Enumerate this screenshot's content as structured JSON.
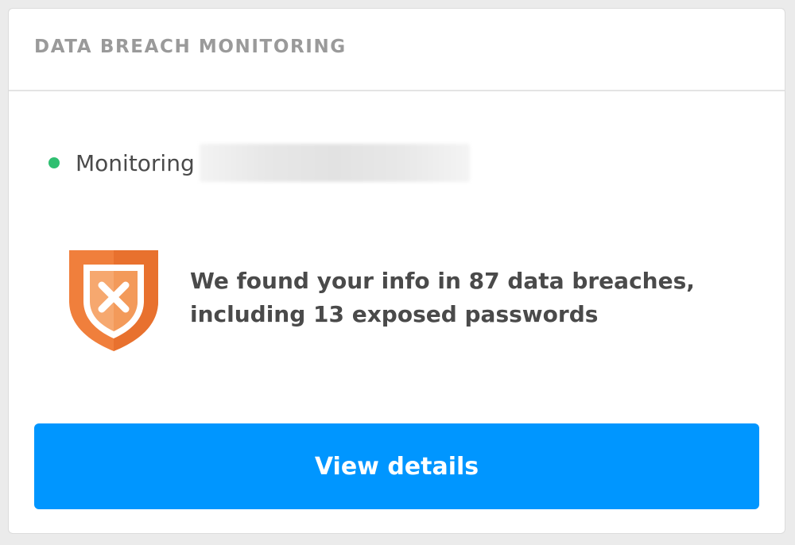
{
  "card": {
    "title": "DATA BREACH MONITORING"
  },
  "monitoring": {
    "label": "Monitoring",
    "status_color": "#2fbf71",
    "status_icon": "status-dot-icon"
  },
  "alert": {
    "icon": "shield-x-icon",
    "line1": "We found your info in 87 data breaches,",
    "line2": "including 13 exposed passwords",
    "breach_count": 87,
    "exposed_passwords": 13
  },
  "cta": {
    "label": "View details",
    "color": "#0096ff"
  },
  "colors": {
    "shield_primary": "#f07f3c",
    "shield_light": "#f6a86f",
    "title_gray": "#9a9a9a",
    "text_dark": "#4a4a4a"
  }
}
